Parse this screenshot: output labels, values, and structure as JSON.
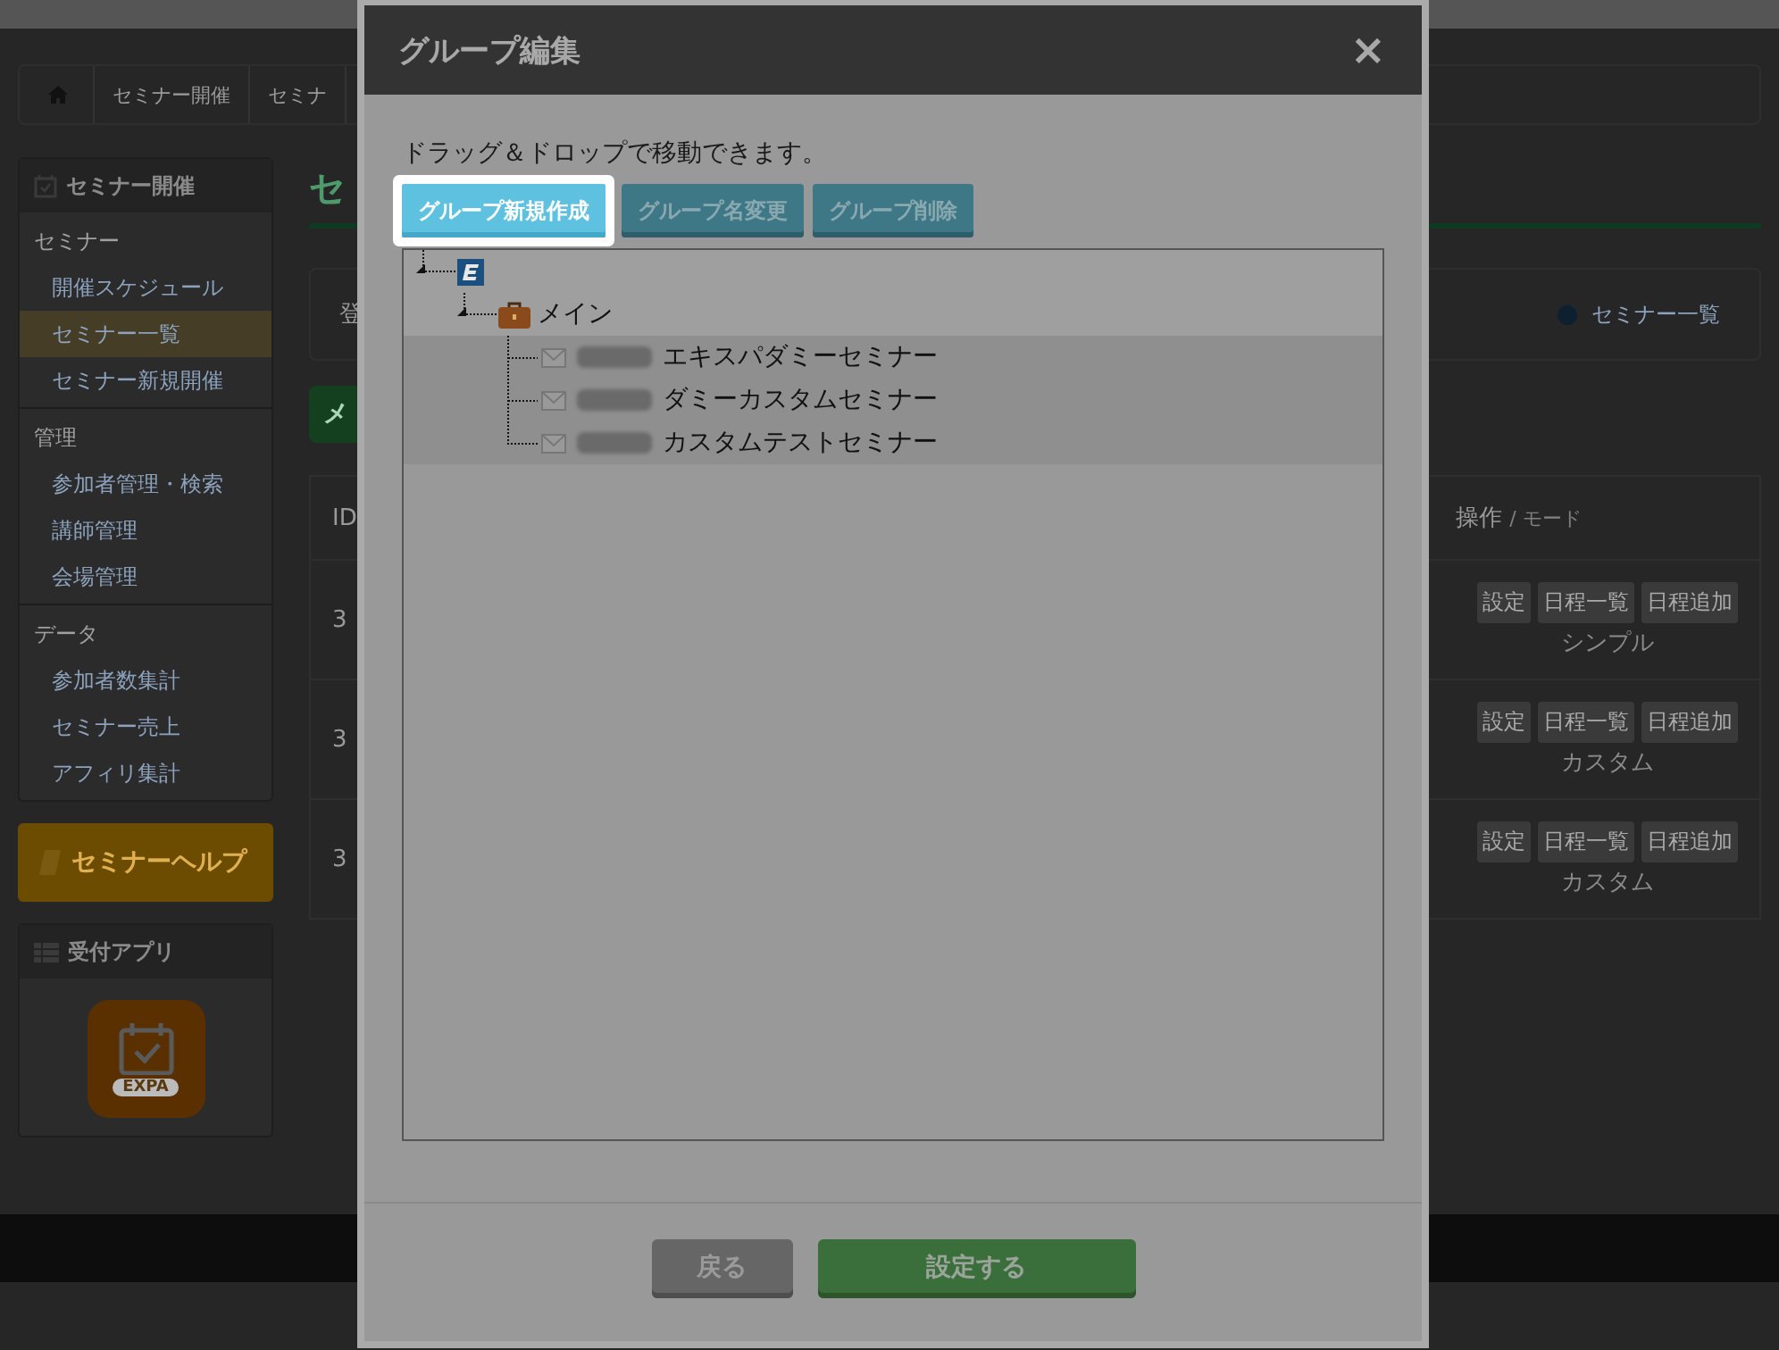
{
  "page": {
    "breadcrumb": [
      "セミナー開催",
      "セミナ"
    ],
    "sidebar": {
      "title": "セミナー開催",
      "sections": [
        {
          "heading": "セミナー",
          "items": [
            {
              "label": "開催スケジュール",
              "selected": false
            },
            {
              "label": "セミナー一覧",
              "selected": true
            },
            {
              "label": "セミナー新規開催",
              "selected": false
            }
          ]
        },
        {
          "heading": "管理",
          "items": [
            {
              "label": "参加者管理・検索",
              "selected": false
            },
            {
              "label": "講師管理",
              "selected": false
            },
            {
              "label": "会場管理",
              "selected": false
            }
          ]
        },
        {
          "heading": "データ",
          "items": [
            {
              "label": "参加者数集計",
              "selected": false
            },
            {
              "label": "セミナー売上",
              "selected": false
            },
            {
              "label": "アフィリ集計",
              "selected": false
            }
          ]
        }
      ]
    },
    "help_button": "セミナーヘルプ",
    "app_panel": {
      "title": "受付アプリ",
      "app_label": "EXPA"
    },
    "main": {
      "title": "セ",
      "info": "登",
      "green_button": "メ",
      "help_link": "セミナー一覧",
      "table": {
        "column_1": "ID",
        "column_2": {
          "label": "操作",
          "sub": "/ モード"
        },
        "rows": [
          {
            "id": "3",
            "actions": [
              "設定",
              "日程一覧",
              "日程追加"
            ],
            "mode": "シンプル"
          },
          {
            "id": "3",
            "actions": [
              "設定",
              "日程一覧",
              "日程追加"
            ],
            "mode": "カスタム"
          },
          {
            "id": "3",
            "actions": [
              "設定",
              "日程一覧",
              "日程追加"
            ],
            "mode": "カスタム"
          }
        ]
      }
    }
  },
  "dialog": {
    "title": "グループ編集",
    "close": "×",
    "instruction": "ドラッグ＆ドロップで移動できます。",
    "toolbar": [
      {
        "label": "グループ新規作成",
        "highlighted": true
      },
      {
        "label": "グループ名変更",
        "highlighted": false
      },
      {
        "label": "グループ削除",
        "highlighted": false
      }
    ],
    "tree": {
      "kind": "root",
      "children": [
        {
          "kind": "folder",
          "label": "メイン",
          "children": [
            {
              "kind": "seminar",
              "label": "エキスパダミーセミナー"
            },
            {
              "kind": "seminar",
              "label": "ダミーカスタムセミナー"
            },
            {
              "kind": "seminar",
              "label": "カスタムテストセミナー"
            }
          ]
        }
      ]
    },
    "buttons": [
      {
        "kind": "back",
        "label": "戻る"
      },
      {
        "kind": "primary",
        "label": "設定する"
      }
    ]
  }
}
